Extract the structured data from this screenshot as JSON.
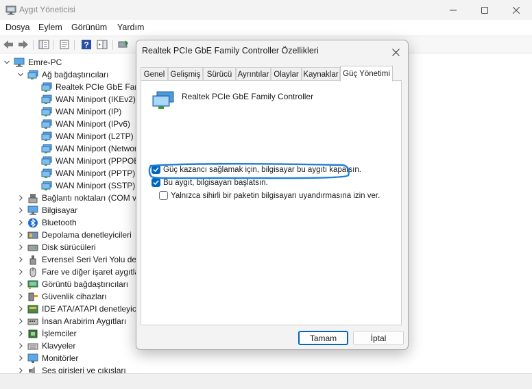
{
  "window": {
    "title": "Aygıt Yöneticisi",
    "icon": "device-manager-icon"
  },
  "menu": {
    "file": "Dosya",
    "action": "Eylem",
    "view": "Görünüm",
    "help": "Yardım"
  },
  "tree": {
    "root": "Emre-PC",
    "network_adapters": {
      "label": "Ağ bağdaştırıcıları",
      "children": [
        "Realtek PCIe GbE Family Controller",
        "WAN Miniport (IKEv2)",
        "WAN Miniport (IP)",
        "WAN Miniport (IPv6)",
        "WAN Miniport (L2TP)",
        "WAN Miniport (Network Monitor)",
        "WAN Miniport (PPPOE)",
        "WAN Miniport (PPTP)",
        "WAN Miniport (SSTP)"
      ]
    },
    "categories": [
      {
        "label": "Bağlantı noktaları (COM ve LPT)",
        "icon": "port-icon"
      },
      {
        "label": "Bilgisayar",
        "icon": "computer-icon"
      },
      {
        "label": "Bluetooth",
        "icon": "bluetooth-icon"
      },
      {
        "label": "Depolama denetleyicileri",
        "icon": "storage-controller-icon"
      },
      {
        "label": "Disk sürücüleri",
        "icon": "disk-drive-icon"
      },
      {
        "label": "Evrensel Seri Veri Yolu denetleyicileri",
        "icon": "usb-icon"
      },
      {
        "label": "Fare ve diğer işaret aygıtları",
        "icon": "mouse-icon"
      },
      {
        "label": "Görüntü bağdaştırıcıları",
        "icon": "display-adapter-icon"
      },
      {
        "label": "Güvenlik cihazları",
        "icon": "security-device-icon"
      },
      {
        "label": "IDE ATA/ATAPI denetleyicileri",
        "icon": "ide-controller-icon"
      },
      {
        "label": "İnsan Arabirim Aygıtları",
        "icon": "hid-icon"
      },
      {
        "label": "İşlemciler",
        "icon": "processor-icon"
      },
      {
        "label": "Klavyeler",
        "icon": "keyboard-icon"
      },
      {
        "label": "Monitörler",
        "icon": "monitor-icon"
      },
      {
        "label": "Ses girişleri ve çıkışları",
        "icon": "audio-icon"
      }
    ]
  },
  "dialog": {
    "title": "Realtek PCIe GbE Family Controller Özellikleri",
    "tabs": [
      "Genel",
      "Gelişmiş",
      "Sürücü",
      "Ayrıntılar",
      "Olaylar",
      "Kaynaklar",
      "Güç Yönetimi"
    ],
    "active_tab": "Güç Yönetimi",
    "device_name": "Realtek PCIe GbE Family Controller",
    "options": [
      {
        "label": "Güç kazancı sağlamak için, bilgisayar bu aygıtı kapatsın.",
        "checked": true
      },
      {
        "label": "Bu aygıt, bilgisayarı başlatsın.",
        "checked": true
      },
      {
        "label": "Yalnızca sihirli bir paketin bilgisayarı uyandırmasına izin ver.",
        "checked": false
      }
    ],
    "ok": "Tamam",
    "cancel": "İptal"
  },
  "colors": {
    "accent": "#0067c0",
    "annotation": "#1f7fd6"
  }
}
